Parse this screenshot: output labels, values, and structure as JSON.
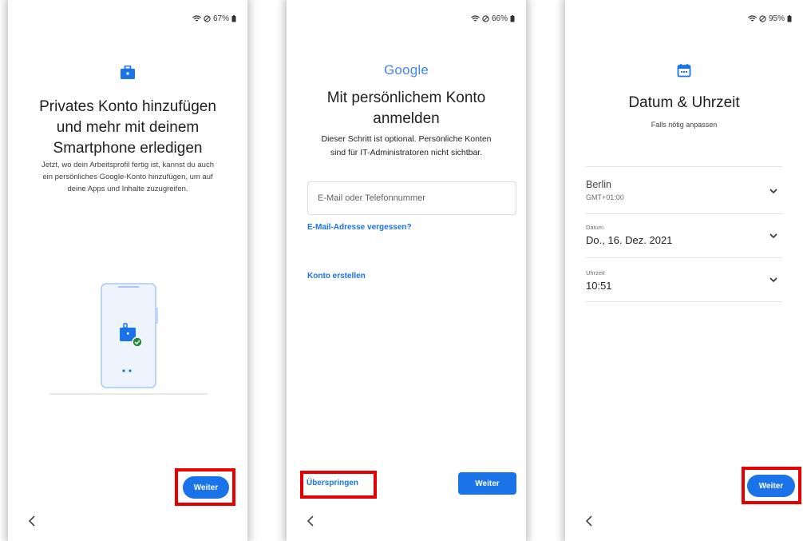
{
  "screens": [
    {
      "status": {
        "battery": "67%"
      },
      "icon": "briefcase-icon",
      "title_lines": [
        "Privates Konto hinzufügen",
        "und mehr mit deinem",
        "Smartphone erledigen"
      ],
      "body_lines": [
        "Jetzt, wo dein Arbeitsprofil fertig ist, kannst du auch",
        "ein persönliches Google-Konto hinzufügen, um auf",
        "deine Apps und Inhalte zuzugreifen."
      ],
      "next_label": "Weiter"
    },
    {
      "status": {
        "battery": "66%"
      },
      "logo_text": "Google",
      "title_lines": [
        "Mit persönlichem Konto",
        "anmelden"
      ],
      "body_lines": [
        "Dieser Schritt ist optional. Persönliche Konten",
        "sind für IT-Administratoren nicht sichtbar."
      ],
      "email_placeholder": "E-Mail oder Telefonnummer",
      "forgot_link": "E-Mail-Adresse vergessen?",
      "create_link": "Konto erstellen",
      "skip_label": "Überspringen",
      "next_label": "Weiter"
    },
    {
      "status": {
        "battery": "95%"
      },
      "icon": "calendar-icon",
      "title": "Datum & Uhrzeit",
      "subtitle": "Falls nötig anpassen",
      "timezone": {
        "value": "Berlin",
        "sub": "GMT+01:00"
      },
      "date": {
        "label": "Datum",
        "value": "Do., 16. Dez. 2021"
      },
      "time": {
        "label": "Uhrzeit",
        "value": "10:51"
      },
      "next_label": "Weiter"
    }
  ],
  "colors": {
    "accent": "#1a73e8",
    "highlight": "#e60000",
    "check": "#1e8e3e"
  }
}
